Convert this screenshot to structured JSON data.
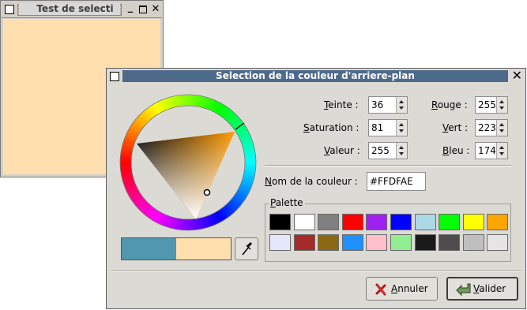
{
  "bg_window": {
    "title": "Test de selecti",
    "client_color": "#ffdfae"
  },
  "dialog": {
    "title": "Selection de la couleur d'arriere-plan",
    "fields": {
      "hue": {
        "label_u": "T",
        "label_rest": "einte :",
        "value": "36"
      },
      "saturation": {
        "label_u": "S",
        "label_rest": "aturation :",
        "value": "81"
      },
      "value": {
        "label_u": "V",
        "label_rest": "aleur :",
        "value": "255"
      },
      "red": {
        "label_u": "R",
        "label_rest": "ouge :",
        "value": "255"
      },
      "green": {
        "label_u": "V",
        "label_rest": "ert :",
        "value": "223"
      },
      "blue": {
        "label_u": "B",
        "label_rest": "leu :",
        "value": "174"
      }
    },
    "color_name": {
      "label_u": "N",
      "label_rest": "om de la couleur :",
      "value": "#FFDFAE"
    },
    "palette": {
      "label_u": "P",
      "label_rest": "alette",
      "colors": [
        "#000000",
        "#ffffff",
        "#808080",
        "#ff0000",
        "#a020f0",
        "#0000ff",
        "#add8e6",
        "#00ff00",
        "#ffff00",
        "#ffa500",
        "#e6e6fa",
        "#a52a2a",
        "#8b6914",
        "#1e90ff",
        "#ffc0cb",
        "#90ee90",
        "#1a1a1a",
        "#4d4d4d",
        "#bfbfbf",
        "#e5e5e5"
      ]
    },
    "preview": {
      "previous": "#4f98b0",
      "current": "#ffdfae"
    },
    "buttons": {
      "cancel_u": "A",
      "cancel_rest": "nnuler",
      "ok_u": "V",
      "ok_rest": "alider"
    }
  }
}
